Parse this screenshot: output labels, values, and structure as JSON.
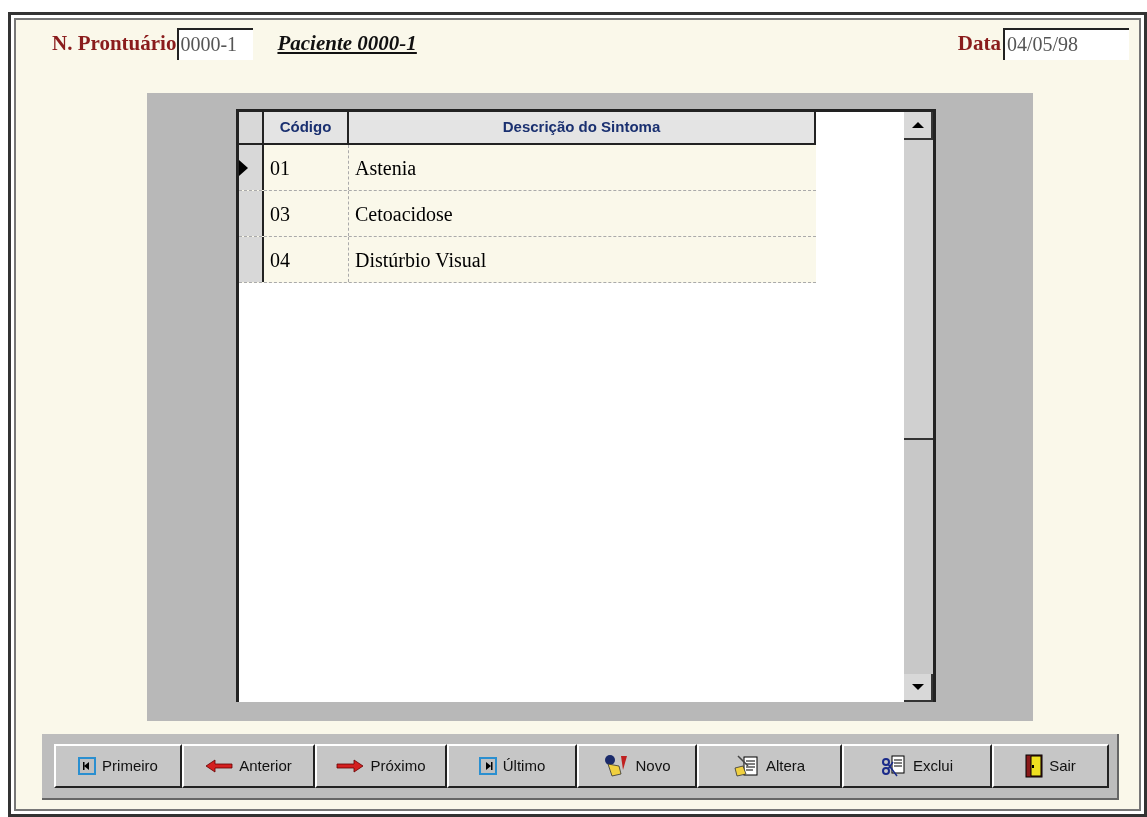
{
  "header": {
    "record_label": "N. Prontuário",
    "record_value": "0000-1",
    "patient": "Paciente 0000-1",
    "date_label": "Data",
    "date_value": "04/05/98"
  },
  "table": {
    "columns": [
      "Código",
      "Descrição do Sintoma"
    ],
    "rows": [
      {
        "code": "01",
        "description": "Astenia",
        "selected": true
      },
      {
        "code": "03",
        "description": "Cetoacidose",
        "selected": false
      },
      {
        "code": "04",
        "description": "Distúrbio Visual",
        "selected": false
      }
    ]
  },
  "toolbar": [
    {
      "kind": "first",
      "label": "Primeiro"
    },
    {
      "kind": "prev",
      "label": "Anterior"
    },
    {
      "kind": "next",
      "label": "Próximo"
    },
    {
      "kind": "last",
      "label": "Último"
    },
    {
      "kind": "new",
      "label": "Novo"
    },
    {
      "kind": "edit",
      "label": "Altera"
    },
    {
      "kind": "delete",
      "label": "Exclui"
    },
    {
      "kind": "exit",
      "label": "Sair"
    }
  ]
}
